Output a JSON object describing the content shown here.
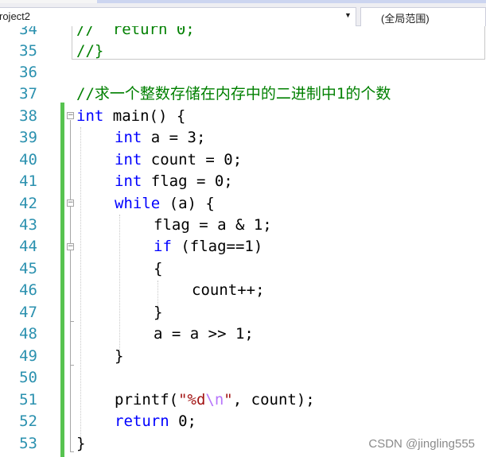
{
  "toolbar": {
    "project_selector": "roject2",
    "scope_selector": "(全局范围)"
  },
  "editor": {
    "lines": [
      {
        "no": "34",
        "code": "//  return 0;"
      },
      {
        "no": "35",
        "code": "//}"
      },
      {
        "no": "36",
        "code": ""
      },
      {
        "no": "37",
        "code": "//求一个整数存储在内存中的二进制中1的个数"
      },
      {
        "no": "38",
        "code": "int main() {"
      },
      {
        "no": "39",
        "code": "int a = 3;"
      },
      {
        "no": "40",
        "code": "int count = 0;"
      },
      {
        "no": "41",
        "code": "int flag = 0;"
      },
      {
        "no": "42",
        "code": "while (a) {"
      },
      {
        "no": "43",
        "code": "flag = a & 1;"
      },
      {
        "no": "44",
        "code": "if (flag==1)"
      },
      {
        "no": "45",
        "code": "{"
      },
      {
        "no": "46",
        "code": "count++;"
      },
      {
        "no": "47",
        "code": "}"
      },
      {
        "no": "48",
        "code": "a = a >> 1;"
      },
      {
        "no": "49",
        "code": "}"
      },
      {
        "no": "50",
        "code": ""
      },
      {
        "no": "51",
        "code": "printf(\"%d\\n\", count);"
      },
      {
        "no": "52",
        "code": "return 0;"
      },
      {
        "no": "53",
        "code": "}"
      }
    ],
    "tokens": {
      "kw_int": "int",
      "kw_while": "while",
      "kw_if": "if",
      "kw_return": "return",
      "fn_main": " main() {",
      "decl_a": " a = 3;",
      "decl_count": " count = 0;",
      "decl_flag": " flag = 0;",
      "while_rest": " (a) {",
      "if_rest": " (flag==1)",
      "printf_open": "printf(",
      "str_open": "\"%d",
      "str_esc": "\\n",
      "str_close": "\"",
      "printf_rest": ", count);",
      "return_rest": " 0;"
    }
  },
  "colors": {
    "keyword": "#0000ff",
    "comment": "#008000",
    "string": "#a31515",
    "escape": "#b776fb",
    "line_number": "#2b91af",
    "change_marker": "#57c350"
  },
  "watermark": "CSDN @jingling555"
}
